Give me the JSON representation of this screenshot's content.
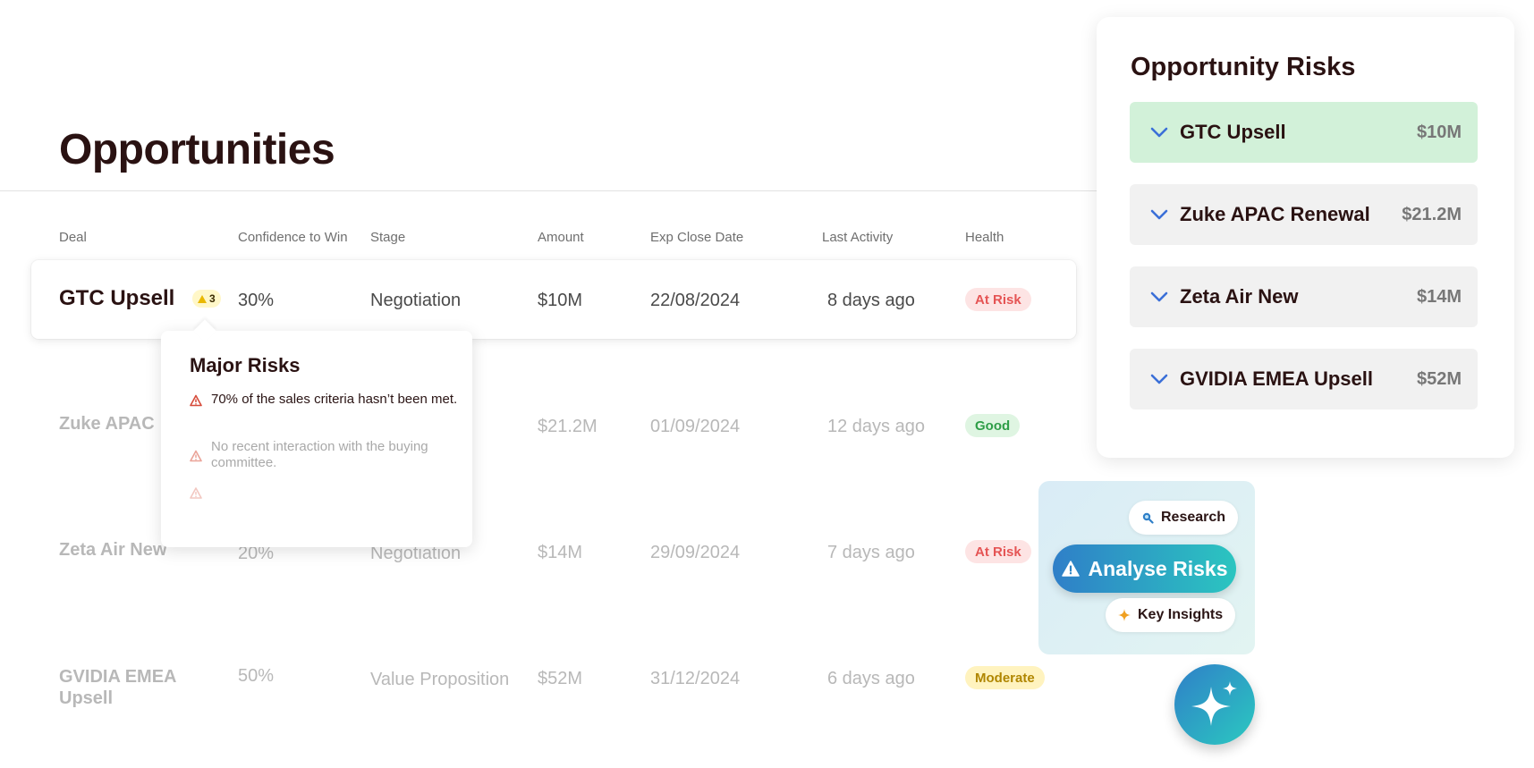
{
  "page": {
    "title": "Opportunities"
  },
  "table": {
    "headers": [
      "Deal",
      "Confidence to Win",
      "Stage",
      "Amount",
      "Exp Close Date",
      "Last Activity",
      "Health"
    ],
    "rows": [
      {
        "deal": "GTC Upsell",
        "risk_count": "3",
        "confidence": "30%",
        "stage": "Negotiation",
        "amount": "$10M",
        "close_date": "22/08/2024",
        "last_activity": "8 days ago",
        "health": "At Risk"
      },
      {
        "deal": "Zuke APAC",
        "confidence": "",
        "stage": "",
        "amount": "$21.2M",
        "close_date": "01/09/2024",
        "last_activity": "12 days ago",
        "health": "Good"
      },
      {
        "deal": "Zeta Air New",
        "confidence": "20%",
        "stage": "Negotiation",
        "amount": "$14M",
        "close_date": "29/09/2024",
        "last_activity": "7 days ago",
        "health": "At Risk"
      },
      {
        "deal_line1": "GVIDIA EMEA",
        "deal_line2": "Upsell",
        "confidence": "50%",
        "stage": "Value Proposition",
        "amount": "$52M",
        "close_date": "31/12/2024",
        "last_activity": "6 days ago",
        "health": "Moderate"
      }
    ]
  },
  "popover": {
    "title": "Major Risks",
    "items": [
      "70% of the sales criteria hasn’t been met.",
      "No recent interaction with the buying committee.",
      ""
    ]
  },
  "panel": {
    "title": "Opportunity Risks",
    "items": [
      {
        "name": "GTC Upsell",
        "amount": "$10M"
      },
      {
        "name": "Zuke APAC Renewal",
        "amount": "$21.2M"
      },
      {
        "name": "Zeta Air New",
        "amount": "$14M"
      },
      {
        "name": "GVIDIA EMEA Upsell",
        "amount": "$52M"
      }
    ]
  },
  "actions": {
    "research": "Research",
    "analyse": "Analyse Risks",
    "insights": "Key Insights"
  },
  "icons": {
    "risk_count": "warning-triangle-icon",
    "popover_items": "warning-triangle-icon",
    "panel_items": "chevron-down-icon",
    "research": "search-icon",
    "analyse": "warning-triangle-icon",
    "insights": "sparkle-icon",
    "fab": "sparkle-icon"
  },
  "colors": {
    "accent_blue": "#2f7fc8",
    "accent_teal": "#2bc5c0",
    "risk_red": "#e55454",
    "good_green": "#2f9e48",
    "moderate_yellow": "#b08600",
    "panel_active": "#d2f1d9"
  }
}
